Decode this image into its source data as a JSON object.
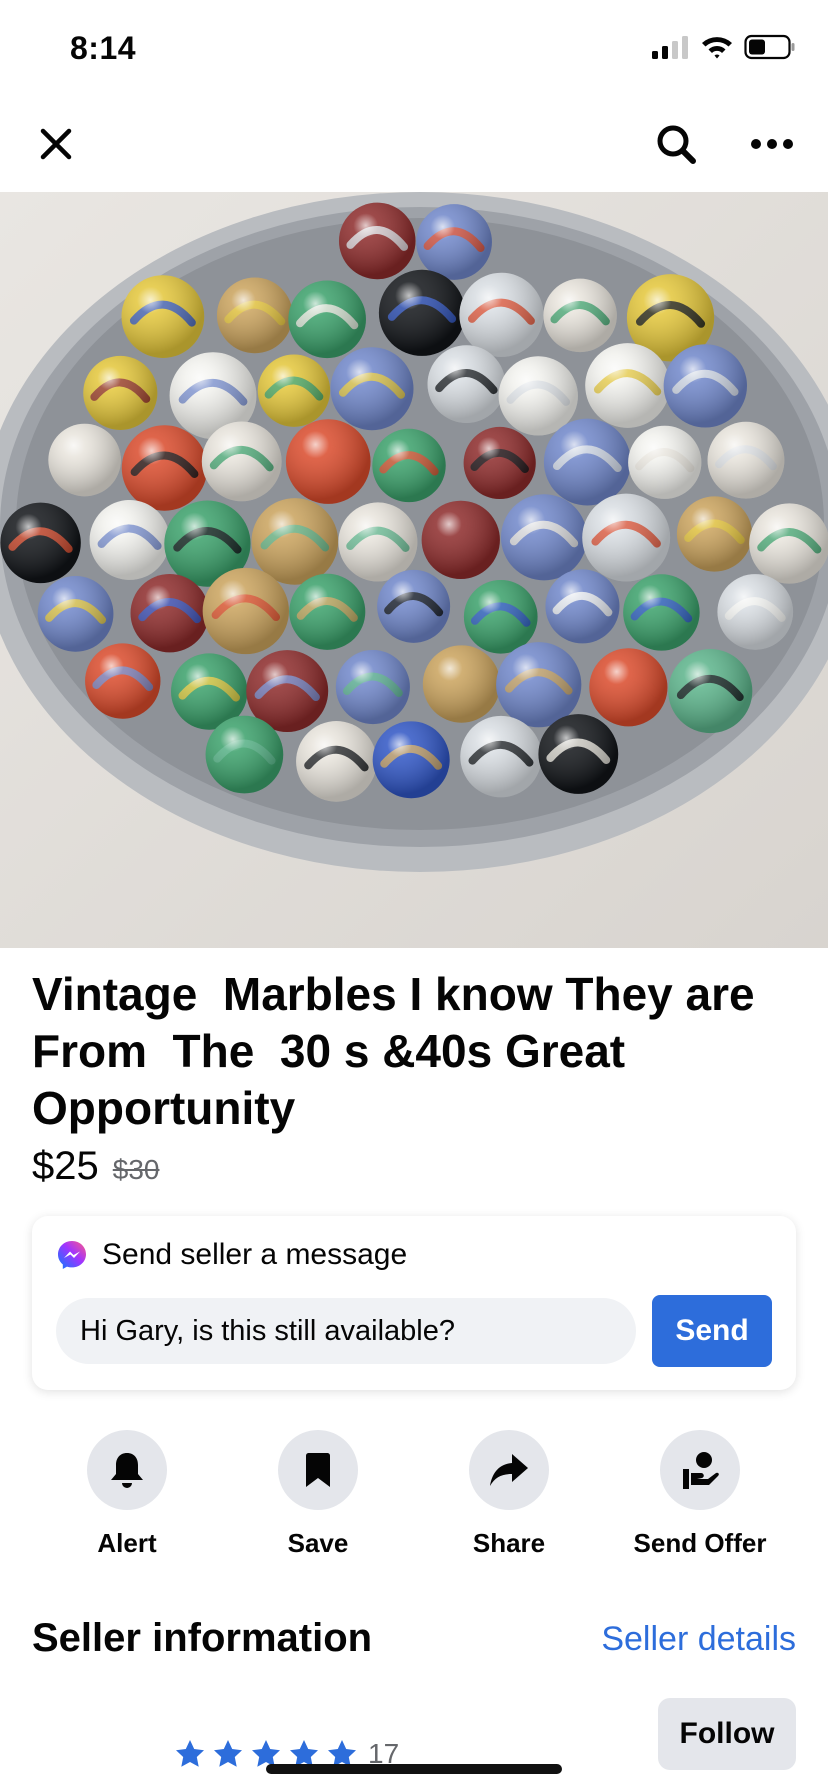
{
  "status_bar": {
    "time": "8:14",
    "icons": [
      "signal-icon",
      "wifi-icon",
      "battery-icon"
    ]
  },
  "nav": {
    "close_icon": "close-icon",
    "search_icon": "search-icon",
    "more_icon": "more-icon"
  },
  "photo": {
    "page_count": 4,
    "active_page": 1
  },
  "listing": {
    "title": "Vintage  Marbles I know They are From  The  30 s &40s Great Opportunity",
    "price": "$25",
    "original_price": "$30"
  },
  "message": {
    "heading": "Send seller a message",
    "input_value": "Hi Gary, is this still available?",
    "send_label": "Send",
    "icon": "messenger-icon"
  },
  "actions": [
    {
      "label": "Alert",
      "icon": "bell-icon"
    },
    {
      "label": "Save",
      "icon": "bookmark-icon"
    },
    {
      "label": "Share",
      "icon": "share-arrow-icon"
    },
    {
      "label": "Send Offer",
      "icon": "offer-icon"
    }
  ],
  "seller": {
    "heading": "Seller information",
    "details_link": "Seller details",
    "follow_label": "Follow",
    "rating_stars": 5,
    "rating_count": "17"
  },
  "colors": {
    "accent": "#2d6ddb",
    "secondary_text": "#65676b",
    "button_bg": "#e4e6eb",
    "star": "#2d6ddb"
  }
}
